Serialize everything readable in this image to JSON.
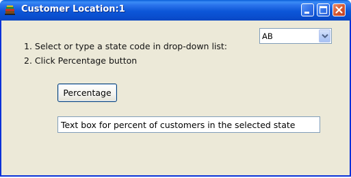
{
  "window": {
    "title": "Customer Location:1",
    "title_color": "#ffffff",
    "titlebar_color": "#0a4fcf",
    "background_color": "#ece9d8"
  },
  "title_buttons": {
    "minimize_icon": "minimize-icon",
    "maximize_icon": "maximize-icon",
    "close_icon": "close-icon"
  },
  "instructions": {
    "line1": "1. Select or type a state code in drop-down list:",
    "line2": "2. Click Percentage button"
  },
  "state_dropdown": {
    "selected_value": "AB",
    "icon": "chevron-down-icon"
  },
  "percentage_button": {
    "label": "Percentage"
  },
  "result_textbox": {
    "value": "Text box for percent of customers in the selected state"
  }
}
